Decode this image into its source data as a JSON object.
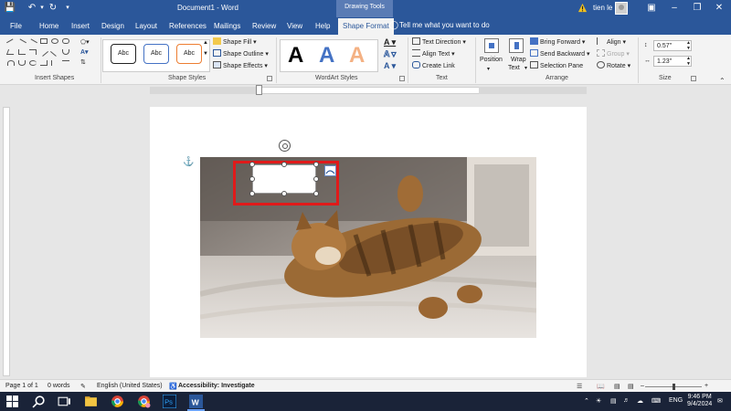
{
  "titlebar": {
    "doc_title": "Document1 - Word",
    "context_tab": "Drawing Tools",
    "user_name": "tien le",
    "window_controls": [
      "restore-ribbon-icon",
      "minimize-icon",
      "maximize-icon",
      "close-icon"
    ]
  },
  "tabs": {
    "items": [
      "File",
      "Home",
      "Insert",
      "Design",
      "Layout",
      "References",
      "Mailings",
      "Review",
      "View",
      "Help",
      "Shape Format"
    ],
    "active": "Shape Format",
    "tell_me": "Tell me what you want to do"
  },
  "ribbon": {
    "insert_shapes": {
      "label": "Insert Shapes"
    },
    "shape_styles": {
      "label": "Shape Styles",
      "swatches": [
        "Abc",
        "Abc",
        "Abc"
      ],
      "swatch_colors": [
        "#222222",
        "#4472c4",
        "#ed7d31"
      ],
      "fill": "Shape Fill",
      "outline": "Shape Outline",
      "effects": "Shape Effects"
    },
    "wordart_styles": {
      "label": "WordArt Styles",
      "letters": [
        "A",
        "A",
        "A"
      ],
      "letter_colors": [
        "#000000",
        "#4472c4",
        "#f4b183"
      ]
    },
    "text": {
      "label": "Text",
      "direction": "Text Direction",
      "align": "Align Text",
      "link": "Create Link"
    },
    "arrange": {
      "label": "Arrange",
      "position": "Position",
      "wrap_text": [
        "Wrap",
        "Text"
      ],
      "bring_forward": "Bring Forward",
      "send_backward": "Send Backward",
      "selection_pane": "Selection Pane",
      "align": "Align",
      "group": "Group",
      "rotate": "Rotate"
    },
    "size": {
      "label": "Size",
      "height": "0.57\"",
      "width": "1.23\""
    }
  },
  "statusbar": {
    "page": "Page 1 of 1",
    "words": "0 words",
    "language": "English (United States)",
    "accessibility": "Accessibility: Investigate",
    "zoom_fraction": 0.5
  },
  "taskbar": {
    "lang": "ENG",
    "time": "9:46 PM",
    "date": "9/4/2024"
  },
  "colors": {
    "word_blue": "#2b579a",
    "selection_red": "#e01a1a",
    "taskbar": "#1a2338"
  }
}
